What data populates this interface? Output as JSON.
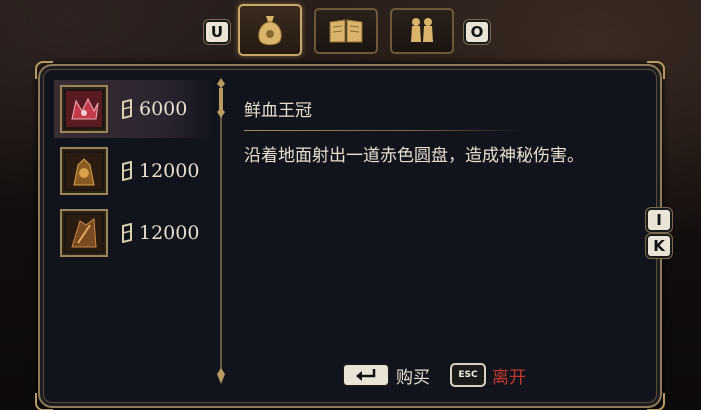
{
  "tabs": {
    "prev_key": "U",
    "next_key": "O",
    "items": [
      {
        "icon": "money-bag-icon",
        "active": true
      },
      {
        "icon": "book-icon",
        "active": false
      },
      {
        "icon": "chess-pieces-icon",
        "active": false
      }
    ]
  },
  "shop": {
    "items": [
      {
        "price": "6000",
        "icon": "blood-crown-icon",
        "selected": true
      },
      {
        "price": "12000",
        "icon": "gold-relic-icon",
        "selected": false
      },
      {
        "price": "12000",
        "icon": "bronze-relic-icon",
        "selected": false
      }
    ],
    "currency_icon": "coin-icon"
  },
  "detail": {
    "title": "鲜血王冠",
    "description": "沿着地面射出一道赤色圆盘，造成神秘伤害。"
  },
  "side_keys": {
    "up": "I",
    "down": "K"
  },
  "footer": {
    "buy_label": "购买",
    "esc_key": "ESC",
    "leave_label": "离开"
  },
  "colors": {
    "gold_border": "#8f7b55",
    "panel_bg": "#12141d",
    "text": "#e7e0cf",
    "leave_red": "#c2392c"
  }
}
